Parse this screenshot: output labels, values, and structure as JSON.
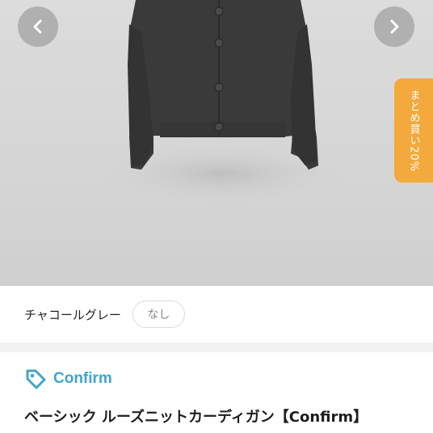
{
  "gallery": {
    "prev_icon": "chevron-left-icon",
    "next_icon": "chevron-right-icon",
    "promo_badge": "まとめ買い20%"
  },
  "variant": {
    "label": "チャコールグレー",
    "option": "なし"
  },
  "brand": {
    "icon": "tag-icon",
    "name": "Confirm",
    "color": "#3fa6c6"
  },
  "product": {
    "title": "ベーシック ルーズニットカーディガン【Confirm】"
  },
  "colors": {
    "promo": "#f4a93d",
    "garment": "#3b3b3b"
  }
}
